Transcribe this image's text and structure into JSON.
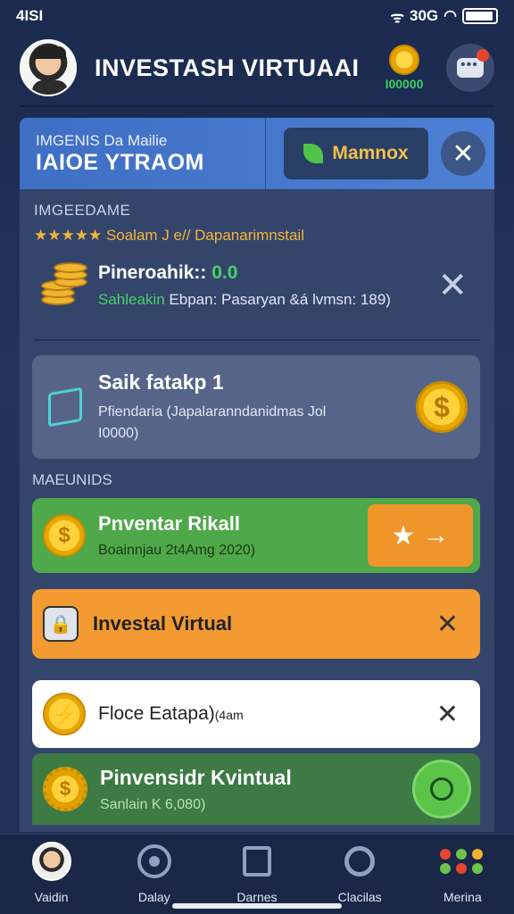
{
  "status": {
    "time": "4ISI",
    "right": "30G"
  },
  "header": {
    "title": "INVESTASH VIRTUAAI",
    "coin_amount": "I00000"
  },
  "banner": {
    "subtitle": "IMGENIS Da Mailie",
    "title": "IAIOE YTRAOM",
    "button_label": "Mamnox",
    "close": "✕"
  },
  "section1": {
    "label": "IMGEEDAME",
    "stars": "★★★★★",
    "stars_text": "Soalam J e// Dapanarimnstail",
    "item_title": "Pineroahik::",
    "item_value": "0.0",
    "item_sub_green": "Sahleakin",
    "item_sub": "Ebpan: Pasaryan &á lvmsn: 189)",
    "close": "✕"
  },
  "card_gray": {
    "title": "Saik fatakp 1",
    "sub1": "Pfiendaria (Japalaranndanidmas Jol",
    "sub2": "I0000)",
    "coin": "$"
  },
  "section2": {
    "label": "MAEUNIDS"
  },
  "card_green": {
    "title": "Pnventar Rikall",
    "sub": "Boainnjau 2t4Amg 2020)",
    "coin": "$",
    "button_star": "★",
    "button_arrow": "→"
  },
  "card_orange": {
    "title": "Investal Virtual",
    "close": "✕"
  },
  "card_white": {
    "title": "Floce Eatapa)",
    "suffix": "(4am",
    "close": "✕"
  },
  "card_green2": {
    "title": "Pinvensidr Kvintual",
    "sub": "Sanlain K 6,080)",
    "coin": "$"
  },
  "nav": [
    {
      "label": "Vaidin"
    },
    {
      "label": "Dalay"
    },
    {
      "label": "Darnes"
    },
    {
      "label": "Clacilas"
    },
    {
      "label": "Merina"
    }
  ],
  "colors": {
    "background": "#1f2f55",
    "accent_orange": "#f39b32",
    "accent_green": "#4fa84a",
    "banner_blue": "#4d7fd4",
    "gold": "#ffd23c"
  }
}
